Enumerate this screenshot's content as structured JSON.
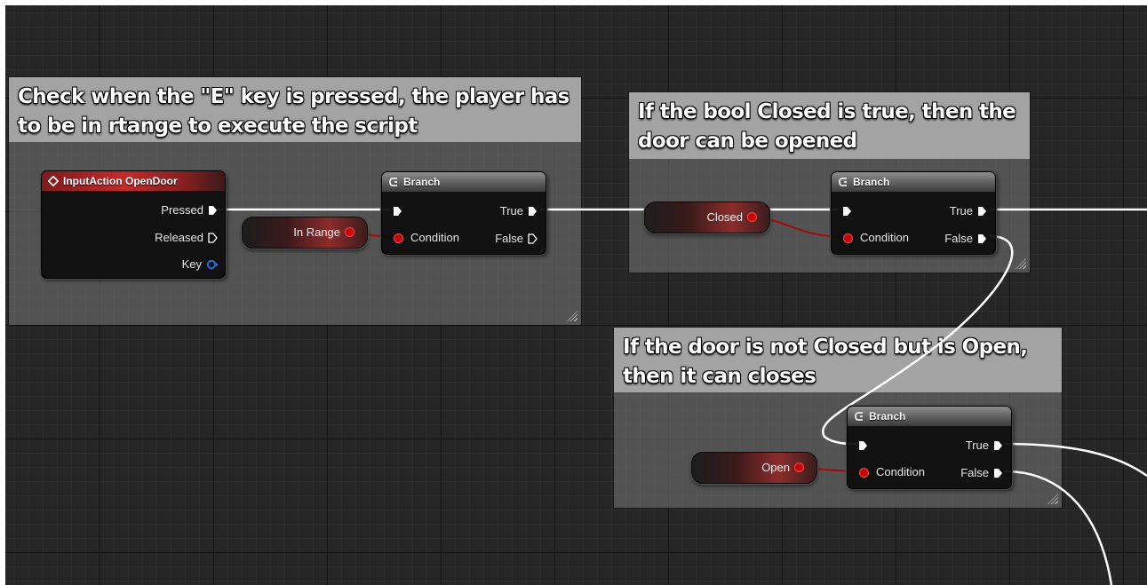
{
  "colors": {
    "exec_wire": "#ffffff",
    "bool_wire": "#a01010",
    "bool_pin": "#c40606",
    "key_pin": "#1e6fe0",
    "event_header": "#c42a2a"
  },
  "comments": [
    {
      "id": "range-check",
      "text": "Check when the \"E\" key is pressed, the player has to be in rtange to execute the script"
    },
    {
      "id": "closed-check",
      "text": "If the bool Closed is true, then the door can be opened"
    },
    {
      "id": "open-check",
      "text": "If the door is not Closed but is Open, then it can closes"
    }
  ],
  "nodes": {
    "input_action": {
      "icon": "diamond-event-icon",
      "title": "InputAction OpenDoor",
      "pins": {
        "pressed": "Pressed",
        "released": "Released",
        "key": "Key"
      }
    },
    "branch_1": {
      "icon": "branch-icon",
      "title": "Branch",
      "condition": "Condition",
      "true_label": "True",
      "false_label": "False"
    },
    "branch_2": {
      "icon": "branch-icon",
      "title": "Branch",
      "condition": "Condition",
      "true_label": "True",
      "false_label": "False"
    },
    "branch_3": {
      "icon": "branch-icon",
      "title": "Branch",
      "condition": "Condition",
      "true_label": "True",
      "false_label": "False"
    }
  },
  "variables": {
    "in_range": "In Range",
    "closed": "Closed",
    "open": "Open"
  }
}
